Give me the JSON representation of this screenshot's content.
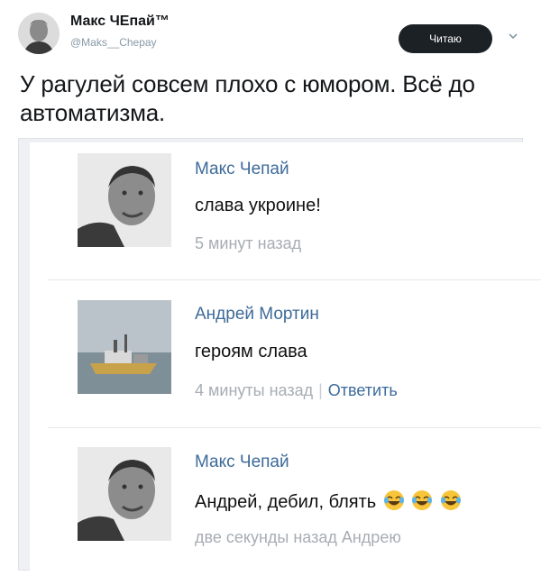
{
  "tweet": {
    "author_name": "Макс ЧЕпай™",
    "handle": "@Maks__Chepay",
    "follow_label": "Читаю",
    "text": "У рагулей совсем плохо с юмором. Всё до автоматизма."
  },
  "comments": [
    {
      "author": "Макс Чепай",
      "text": "слава укроине!",
      "time": "5 минут назад",
      "reply_label": ""
    },
    {
      "author": "Андрей Мортин",
      "text": "героям слава",
      "time": "4 минуты назад",
      "reply_label": "Ответить"
    },
    {
      "author": "Макс Чепай",
      "text": "Андрей, дебил, блять",
      "time": "две секунды назад Андрею",
      "reply_label": ""
    }
  ],
  "icons": {
    "chevron": "chevron-down-icon",
    "emoji": "face-with-tears-of-joy-icon"
  },
  "colors": {
    "link": "#3d6b9a",
    "meta": "#a7adb3",
    "follow_bg": "#1c2126"
  }
}
